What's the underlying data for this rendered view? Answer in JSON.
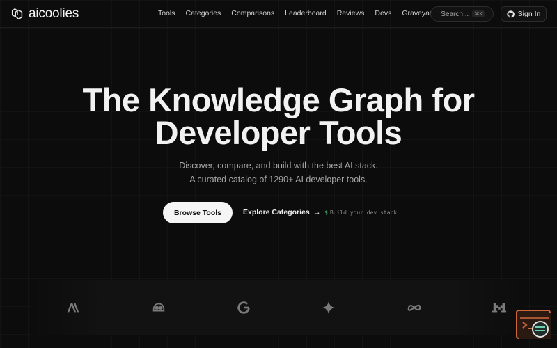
{
  "brand": {
    "name": "aicoolies",
    "icon": "hand-logo-icon"
  },
  "nav": {
    "links": [
      "Tools",
      "Categories",
      "Comparisons",
      "Leaderboard",
      "Reviews",
      "Devs",
      "Graveyard"
    ],
    "search_label": "Search...",
    "search_shortcut": "⌘K",
    "signin_label": "Sign In"
  },
  "hero": {
    "title_line1": "The Knowledge Graph for",
    "title_line2": "Developer Tools",
    "subtitle_line1": "Discover, compare, and build with the best AI stack.",
    "subtitle_line2": "A curated catalog of 1290+ AI developer tools.",
    "primary_cta": "Browse Tools",
    "secondary_cta": "Explore Categories",
    "secondary_arrow": "→",
    "terminal_prompt": "$",
    "terminal_text": "Build your dev stack"
  },
  "logos": [
    "anthropic-icon",
    "copilot-icon",
    "google-icon",
    "gemini-icon",
    "meta-icon",
    "mistral-icon"
  ],
  "feedback_icon": "feedback-chat-icon",
  "colors": {
    "background": "#0c0c0c",
    "accent": "#3fb86a",
    "primary_button": "#f5f5f5",
    "feedback": "#d0673c"
  }
}
